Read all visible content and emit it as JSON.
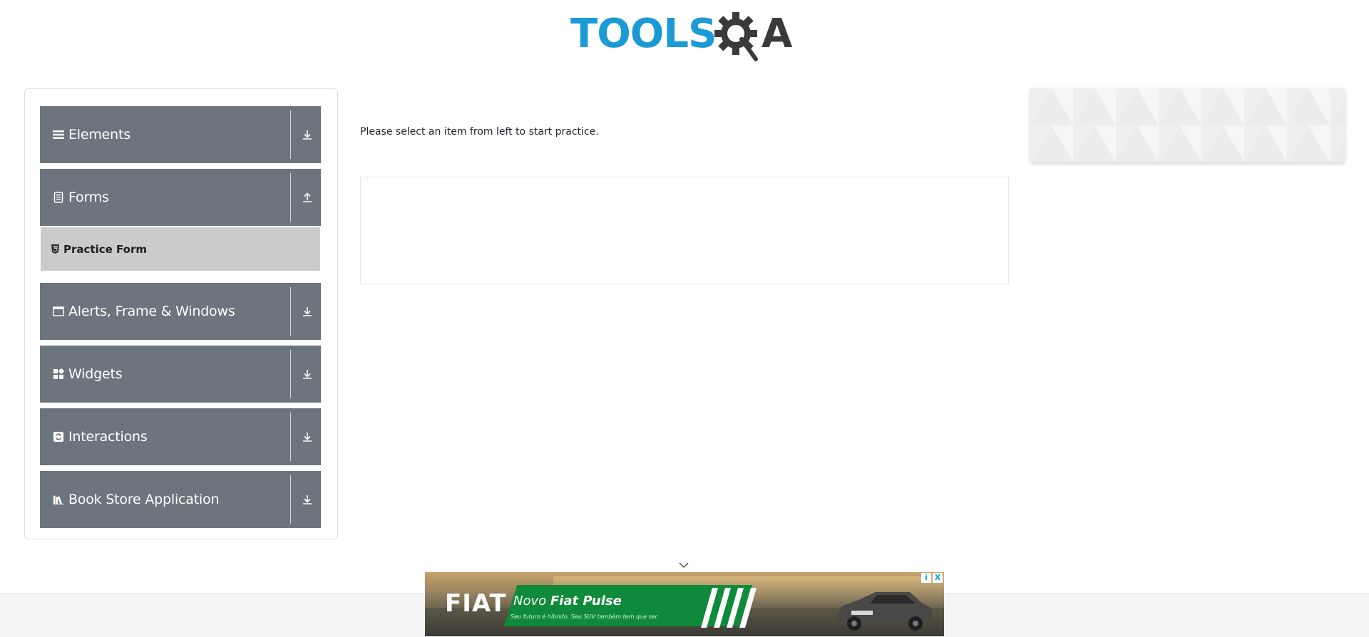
{
  "header": {
    "logo_text_left": "TOOLS",
    "logo_text_right": "A"
  },
  "sidebar": {
    "groups": [
      {
        "title": "Elements",
        "icon": "list-icon",
        "state": "collapsed",
        "arrow": "download-arrow-icon"
      },
      {
        "title": "Forms",
        "icon": "form-icon",
        "state": "expanded",
        "arrow": "upload-arrow-icon"
      },
      {
        "title": "Alerts, Frame & Windows",
        "icon": "window-icon",
        "state": "collapsed",
        "arrow": "download-arrow-icon"
      },
      {
        "title": "Widgets",
        "icon": "widgets-icon",
        "state": "collapsed",
        "arrow": "download-arrow-icon"
      },
      {
        "title": "Interactions",
        "icon": "interactions-icon",
        "state": "collapsed",
        "arrow": "download-arrow-icon"
      },
      {
        "title": "Book Store Application",
        "icon": "book-icon",
        "state": "collapsed",
        "arrow": "download-arrow-icon"
      }
    ],
    "forms_subitems": [
      {
        "label": "Practice Form",
        "icon": "html5-icon"
      }
    ]
  },
  "main": {
    "instruction": "Please select an item from left to start practice."
  },
  "banner": {
    "brand": "FIAT",
    "promo_prefix": "Novo ",
    "promo_name": "Fiat Pulse",
    "promo_sub": "Seu futuro é híbrido. Seu SUV também tem que ser.",
    "ad_info": "i",
    "ad_close": "X"
  },
  "colors": {
    "accent_blue": "#1c9ad6",
    "logo_dark": "#3a3a3a",
    "sidebar_group": "#6c757d",
    "subitem_active": "#cbcbcb"
  }
}
